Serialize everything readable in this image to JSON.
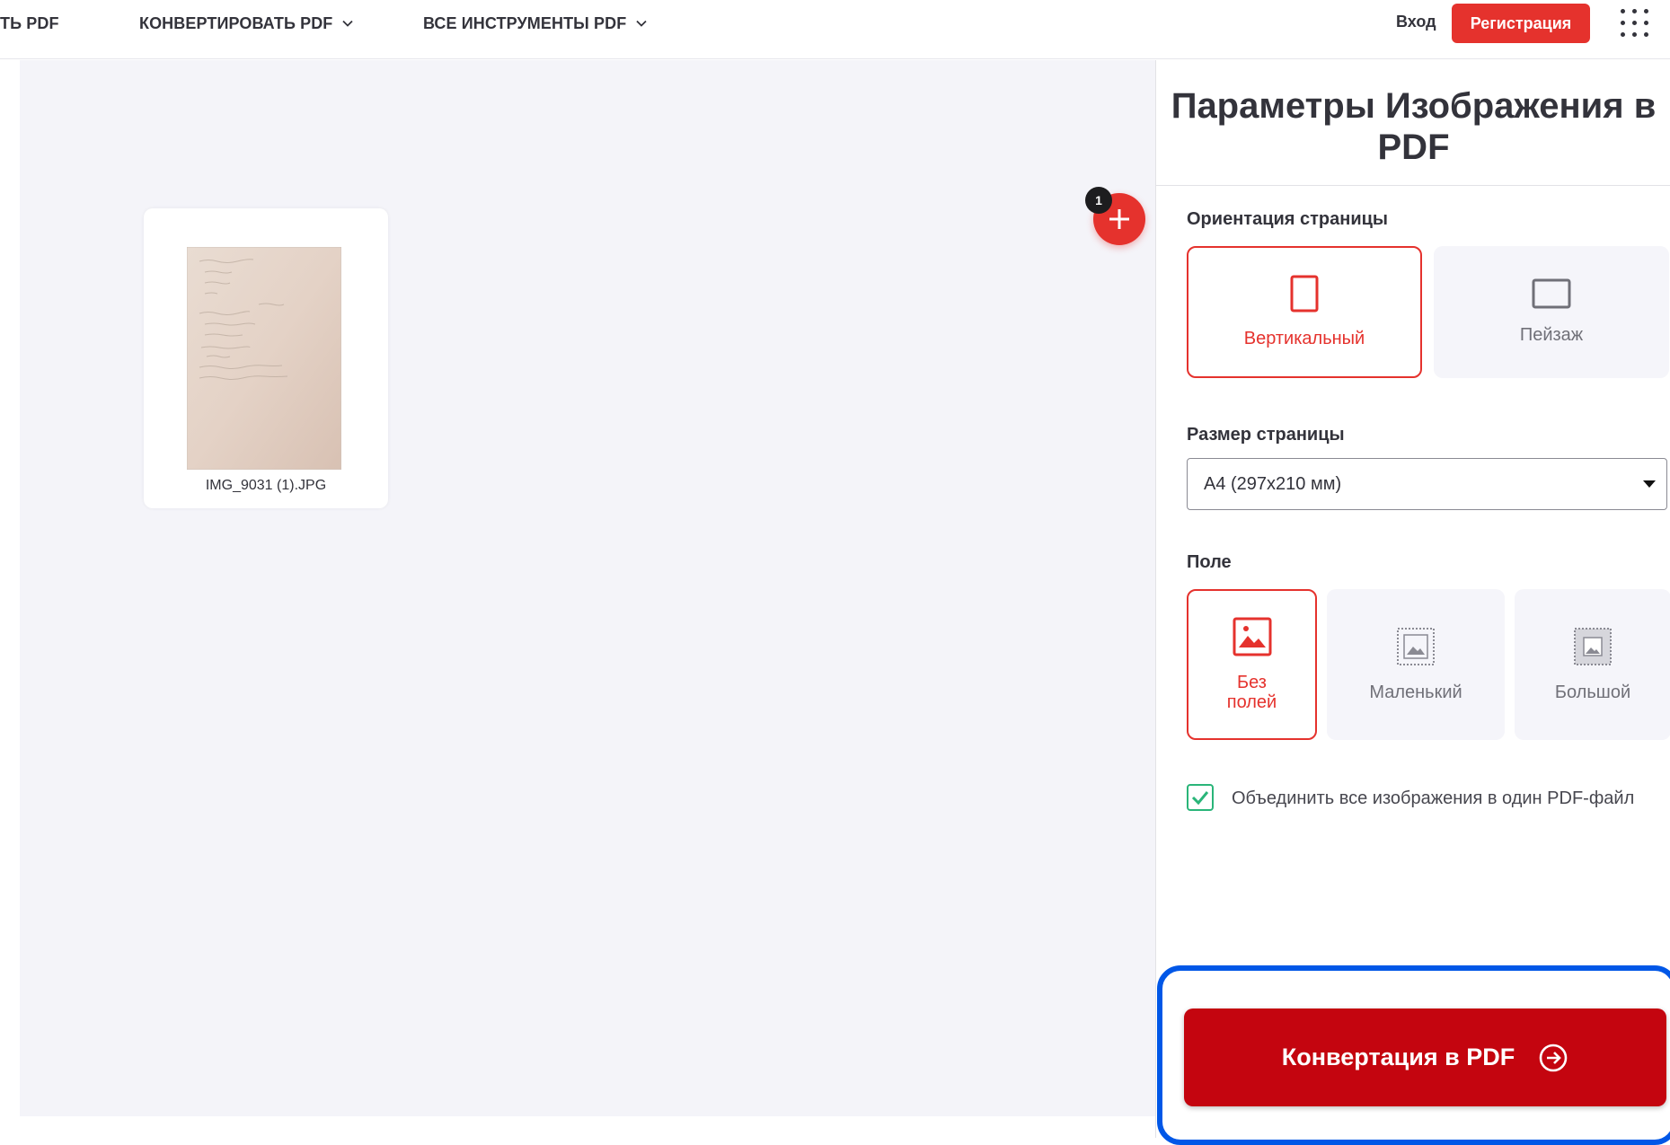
{
  "nav": {
    "items": [
      {
        "label": "ТЬ PDF",
        "has_dropdown": false
      },
      {
        "label": "КОНВЕРТИРОВАТЬ PDF",
        "has_dropdown": true
      },
      {
        "label": "ВСЕ ИНСТРУМЕНТЫ PDF",
        "has_dropdown": true
      }
    ],
    "login": "Вход",
    "register": "Регистрация",
    "apps_icon": "apps-grid-icon"
  },
  "workspace": {
    "file": {
      "name": "IMG_9031 (1).JPG"
    },
    "add_count": "1",
    "add_icon": "plus-icon"
  },
  "sidebar": {
    "title": "Параметры Изображения в PDF",
    "orientation": {
      "label": "Ориентация страницы",
      "options": [
        {
          "label": "Вертикальный",
          "icon": "portrait-icon",
          "selected": true
        },
        {
          "label": "Пейзаж",
          "icon": "landscape-icon",
          "selected": false
        }
      ]
    },
    "page_size": {
      "label": "Размер страницы",
      "value": "A4 (297x210 мм)"
    },
    "margin": {
      "label": "Поле",
      "options": [
        {
          "label": "Без полей",
          "icon": "no-margin-icon",
          "selected": true
        },
        {
          "label": "Маленький",
          "icon": "small-margin-icon",
          "selected": false
        },
        {
          "label": "Большой",
          "icon": "big-margin-icon",
          "selected": false
        }
      ]
    },
    "merge": {
      "checked": true,
      "label": "Объединить все изображения в один PDF-файл"
    },
    "convert_button": "Конвертация в PDF"
  },
  "colors": {
    "brand_red": "#e5322d",
    "convert_red": "#c4050f",
    "highlight_blue": "#0057e7",
    "check_green": "#2ab579",
    "workspace_bg": "#f4f4f9"
  }
}
